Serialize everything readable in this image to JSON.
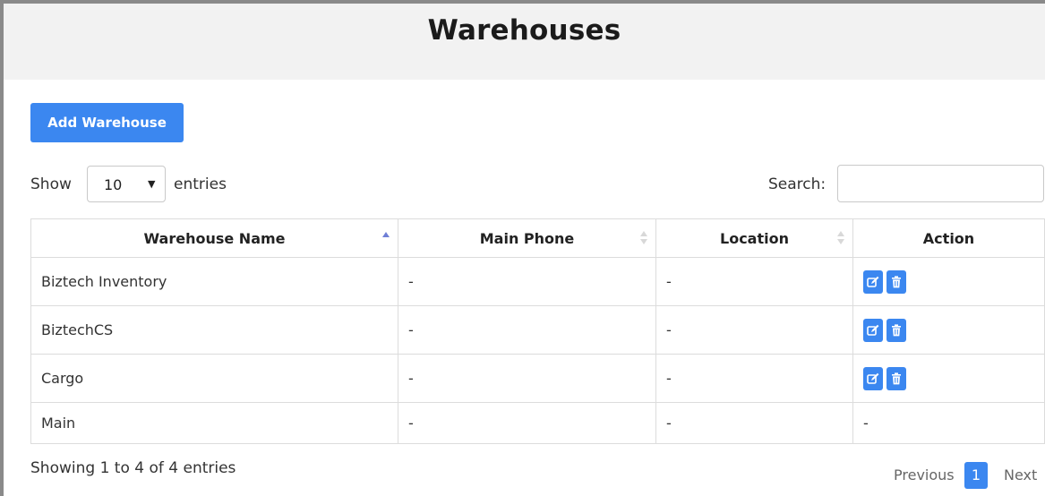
{
  "page": {
    "title": "Warehouses",
    "add_button": "Add Warehouse"
  },
  "length_menu": {
    "show_label": "Show",
    "selected": "10",
    "entries_label": "entries"
  },
  "search": {
    "label": "Search:",
    "value": ""
  },
  "table": {
    "columns": [
      "Warehouse Name",
      "Main Phone",
      "Location",
      "Action"
    ],
    "sorted_column": "Warehouse Name",
    "sort_direction": "ascending",
    "rows": [
      {
        "name": "Biztech Inventory",
        "phone": "-",
        "location": "-",
        "actions": [
          "edit",
          "delete"
        ]
      },
      {
        "name": "BiztechCS",
        "phone": "-",
        "location": "-",
        "actions": [
          "edit",
          "delete"
        ]
      },
      {
        "name": "Cargo",
        "phone": "-",
        "location": "-",
        "actions": [
          "edit",
          "delete"
        ]
      },
      {
        "name": "Main",
        "phone": "-",
        "location": "-",
        "action_text": "-"
      }
    ]
  },
  "footer": {
    "info": "Showing 1 to 4 of 4 entries",
    "previous": "Previous",
    "current_page": "1",
    "next": "Next"
  },
  "colors": {
    "accent": "#3b87f0",
    "header_bg": "#f2f2f2",
    "sort_active": "#6f7fd6"
  },
  "icons": {
    "edit": "edit-icon",
    "delete": "trash-icon"
  }
}
